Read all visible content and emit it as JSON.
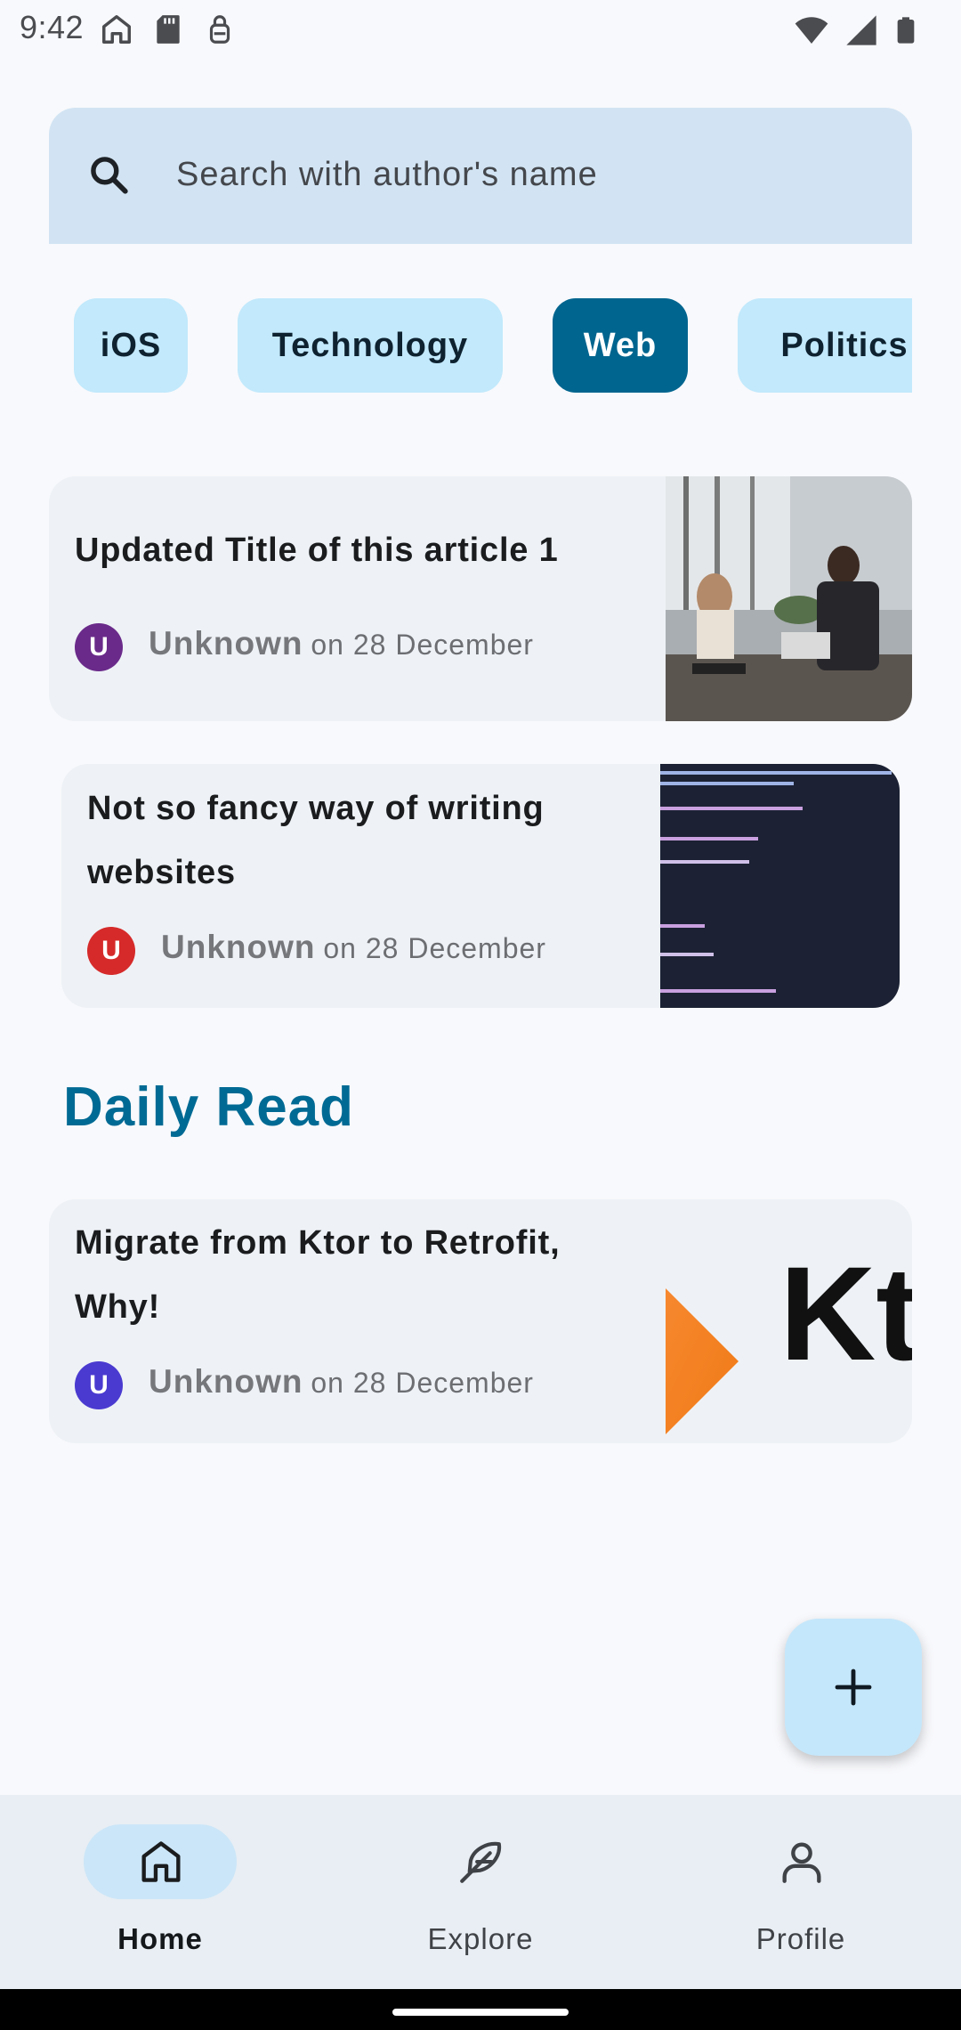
{
  "status_bar": {
    "time": "9:42",
    "left_icons": [
      "home-icon",
      "sd-card-icon",
      "lock-icon"
    ],
    "right_icons": [
      "wifi-icon",
      "cell-signal-icon",
      "battery-icon"
    ]
  },
  "search": {
    "placeholder": "Search with author's name",
    "icon": "search-icon"
  },
  "categories": [
    {
      "label": "iOS",
      "selected": false
    },
    {
      "label": "Technology",
      "selected": false
    },
    {
      "label": "Web",
      "selected": true
    },
    {
      "label": "Politics",
      "selected": false
    }
  ],
  "articles": [
    {
      "title": "Updated Title of this article 1",
      "avatar_initial": "U",
      "avatar_color": "#6a2a8a",
      "author": "Unknown",
      "date": "on 28 December",
      "thumbnail": "office-meeting-photo"
    },
    {
      "title": "Not so fancy way of writing websites",
      "avatar_initial": "U",
      "avatar_color": "#d62a2a",
      "author": "Unknown",
      "date": "on 28 December",
      "thumbnail": "code-editor-screenshot"
    }
  ],
  "daily_read": {
    "heading": "Daily Read",
    "article": {
      "title": "Migrate from Ktor to Retrofit, Why!",
      "avatar_initial": "U",
      "avatar_color": "#4a3ad0",
      "author": "Unknown",
      "date": "on 28 December",
      "thumbnail": "ktor-logo",
      "thumbnail_text": "Kt"
    }
  },
  "fab": {
    "icon": "add-icon"
  },
  "bottom_nav": {
    "items": [
      {
        "label": "Home",
        "icon": "home-icon",
        "active": true
      },
      {
        "label": "Explore",
        "icon": "feather-icon",
        "active": false
      },
      {
        "label": "Profile",
        "icon": "person-icon",
        "active": false
      }
    ]
  },
  "colors": {
    "accent": "#00658f",
    "chip": "#c2e9fc",
    "search_bg": "#d2e4f3",
    "card_bg": "#eef2f6",
    "section_title": "#006a94"
  }
}
